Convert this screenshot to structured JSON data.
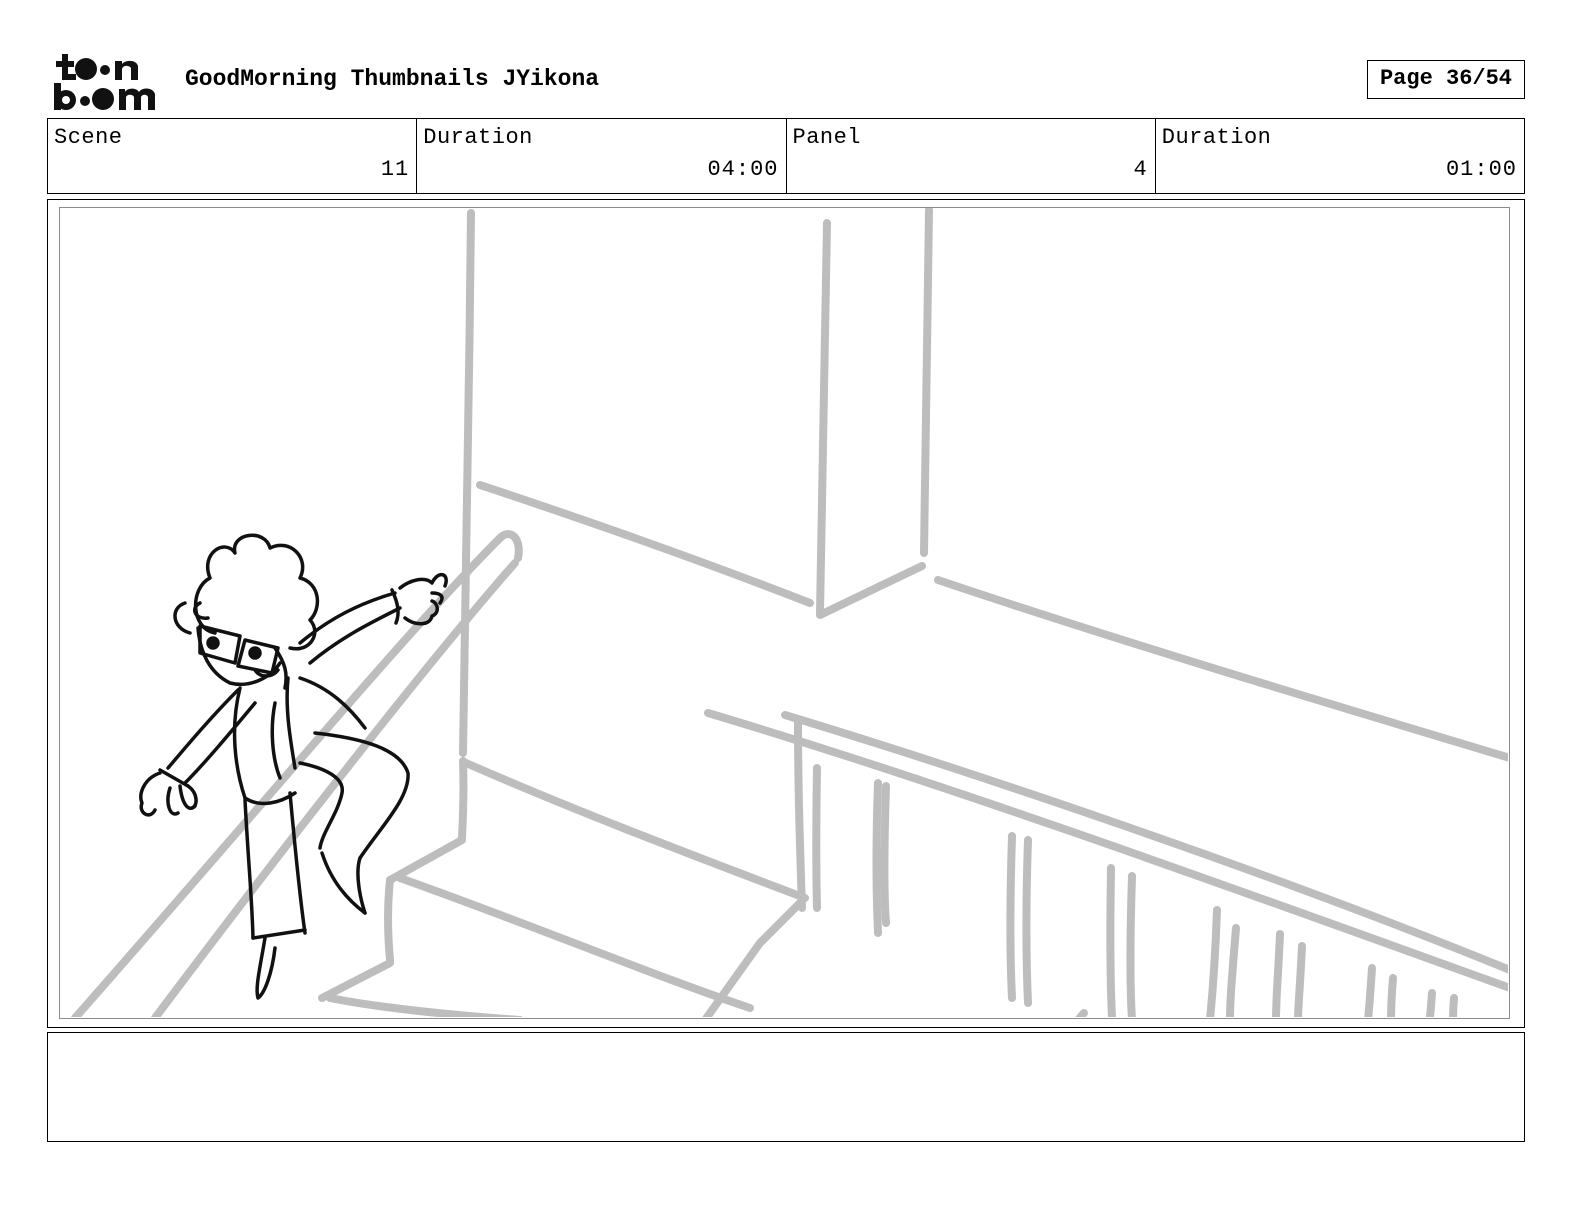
{
  "header": {
    "logo_text_top": "toon",
    "logo_text_bottom": "boom",
    "title": "GoodMorning Thumbnails JYikona",
    "page_label": "Page 36/54"
  },
  "info": [
    {
      "label": "Scene",
      "value": "11"
    },
    {
      "label": "Duration",
      "value": "04:00"
    },
    {
      "label": "Panel",
      "value": "4"
    },
    {
      "label": "Duration",
      "value": "01:00"
    }
  ],
  "panel": {
    "sketch_icon": "storyboard-sketch-character-on-stairs",
    "background_line_color": "#bdbdbd",
    "character_line_color": "#111111"
  },
  "caption": {
    "text": ""
  }
}
